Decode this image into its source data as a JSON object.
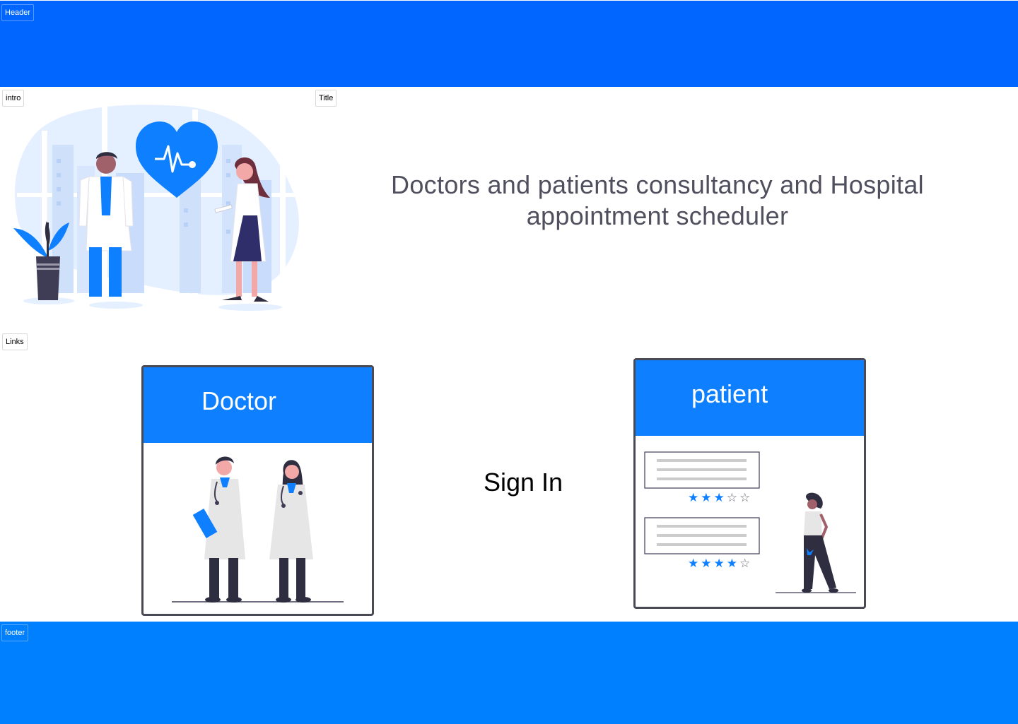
{
  "header": {
    "tag": "Header",
    "color": "#0066ff"
  },
  "intro": {
    "tag": "intro",
    "illustration": "doctors-heart-illustration"
  },
  "title": {
    "tag": "Title",
    "text": "Doctors and patients consultancy and Hospital appointment scheduler"
  },
  "links": {
    "tag": "Links",
    "doctor_card": {
      "label": "Doctor",
      "illustration": "doctors-illustration"
    },
    "signin_label": "Sign In",
    "patient_card": {
      "label": "patient",
      "illustration": "patient-reviews-illustration",
      "ratings": [
        3,
        4
      ]
    }
  },
  "footer": {
    "tag": "footer",
    "color": "#0080ff"
  },
  "colors": {
    "accent": "#0d7fff",
    "text": "#4f4f5e"
  }
}
